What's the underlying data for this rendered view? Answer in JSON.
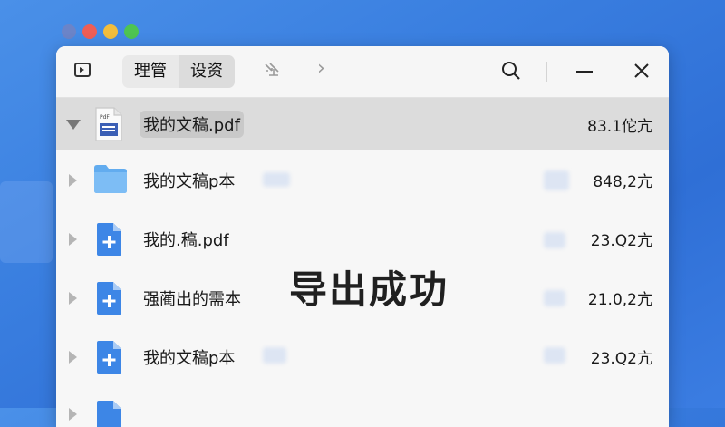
{
  "toolbar": {
    "tab_manage": "理管",
    "tab_assets": "设资"
  },
  "files": [
    {
      "name": "我的文稿.pdf",
      "size": "83.1佗亢",
      "icon": "pdf-doc-icon",
      "selected": true
    },
    {
      "name": "我的文稿p本",
      "size": "848,2亢",
      "icon": "folder-icon"
    },
    {
      "name": "我的.稿.pdf",
      "size": "23.Q2亢",
      "icon": "blue-doc-icon"
    },
    {
      "name": "强蔺出的需本",
      "size": "21.0,2亢",
      "icon": "blue-doc-icon"
    },
    {
      "name": "我的文稿p本",
      "size": "23.Q2亢",
      "icon": "blue-doc-icon"
    }
  ],
  "toast": "导出成功",
  "colors": {
    "accent_blue": "#3b82e6",
    "folder_blue": "#6cb4f2",
    "selected_row": "#dcdcdc"
  }
}
